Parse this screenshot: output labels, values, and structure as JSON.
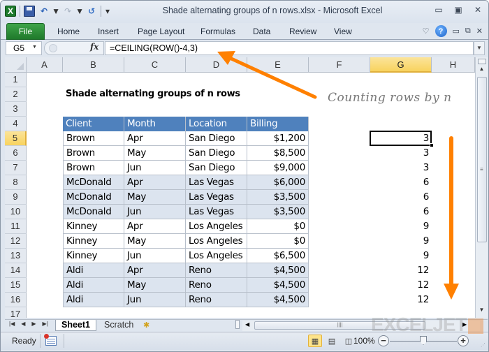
{
  "window": {
    "title": "Shade alternating groups of n rows.xlsx  -  Microsoft Excel",
    "controls": [
      "minimize",
      "maximize",
      "close"
    ]
  },
  "quick_access": {
    "icons": [
      "excel-logo",
      "save-icon",
      "undo-icon",
      "redo-icon",
      "refresh-icon",
      "customize-icon"
    ]
  },
  "ribbon": {
    "file_label": "File",
    "tabs": [
      "Home",
      "Insert",
      "Page Layout",
      "Formulas",
      "Data",
      "Review",
      "View"
    ]
  },
  "formula_bar": {
    "name_box": "G5",
    "fx_label": "fx",
    "formula": "=CEILING(ROW()-4,3)"
  },
  "grid": {
    "columns": [
      "A",
      "B",
      "C",
      "D",
      "E",
      "F",
      "G",
      "H"
    ],
    "selected_column": "G",
    "rows": [
      "1",
      "2",
      "3",
      "4",
      "5",
      "6",
      "7",
      "8",
      "9",
      "10",
      "11",
      "12",
      "13",
      "14",
      "15",
      "16",
      "17"
    ],
    "selected_row": "5",
    "sheet_title": "Shade alternating groups of n rows",
    "table": {
      "headers": [
        "Client",
        "Month",
        "Location",
        "Billing"
      ],
      "rows": [
        {
          "client": "Brown",
          "month": "Apr",
          "location": "San Diego",
          "billing": "$1,200",
          "shaded": false
        },
        {
          "client": "Brown",
          "month": "May",
          "location": "San Diego",
          "billing": "$8,500",
          "shaded": false
        },
        {
          "client": "Brown",
          "month": "Jun",
          "location": "San Diego",
          "billing": "$9,000",
          "shaded": false
        },
        {
          "client": "McDonald",
          "month": "Apr",
          "location": "Las Vegas",
          "billing": "$6,000",
          "shaded": true
        },
        {
          "client": "McDonald",
          "month": "May",
          "location": "Las Vegas",
          "billing": "$3,500",
          "shaded": true
        },
        {
          "client": "McDonald",
          "month": "Jun",
          "location": "Las Vegas",
          "billing": "$3,500",
          "shaded": true
        },
        {
          "client": "Kinney",
          "month": "Apr",
          "location": "Los Angeles",
          "billing": "$0",
          "shaded": false
        },
        {
          "client": "Kinney",
          "month": "May",
          "location": "Los Angeles",
          "billing": "$0",
          "shaded": false
        },
        {
          "client": "Kinney",
          "month": "Jun",
          "location": "Los Angeles",
          "billing": "$6,500",
          "shaded": false
        },
        {
          "client": "Aldi",
          "month": "Apr",
          "location": "Reno",
          "billing": "$4,500",
          "shaded": true
        },
        {
          "client": "Aldi",
          "month": "May",
          "location": "Reno",
          "billing": "$4,500",
          "shaded": true
        },
        {
          "client": "Aldi",
          "month": "Jun",
          "location": "Reno",
          "billing": "$4,500",
          "shaded": true
        }
      ]
    },
    "helper_column": [
      "3",
      "3",
      "3",
      "6",
      "6",
      "6",
      "9",
      "9",
      "9",
      "12",
      "12",
      "12"
    ],
    "annotation": "Counting rows by n"
  },
  "sheet_tabs": {
    "tabs": [
      "Sheet1",
      "Scratch"
    ],
    "active": "Sheet1"
  },
  "status_bar": {
    "status": "Ready",
    "zoom": "100%"
  },
  "colors": {
    "table_header": "#4f81bd",
    "shaded_row": "#dce4ef",
    "arrow": "#ff8000",
    "selected_header": "#f8d35e",
    "file_tab": "#2a8a36"
  },
  "watermark": "EXCELJET"
}
